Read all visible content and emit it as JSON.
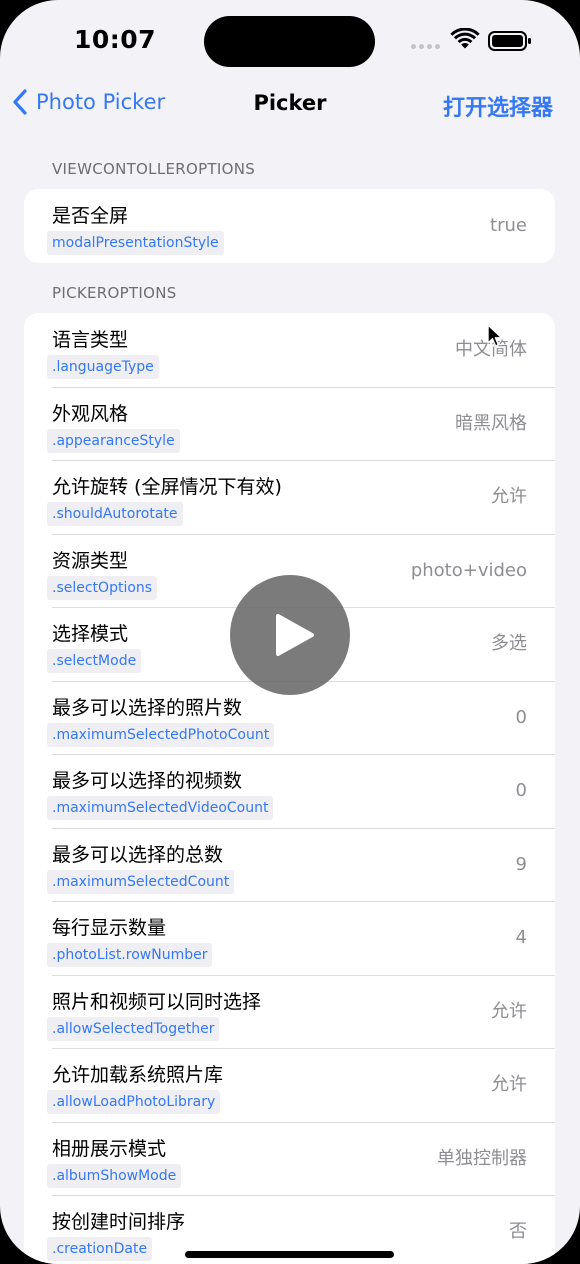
{
  "status_bar": {
    "time": "10:07"
  },
  "nav": {
    "back_label": "Photo Picker",
    "title": "Picker",
    "right_label": "打开选择器"
  },
  "sections": [
    {
      "header": "VIEWCONTOLLEROPTIONS",
      "rows": [
        {
          "title": "是否全屏",
          "tag": "modalPresentationStyle",
          "value": "true"
        }
      ]
    },
    {
      "header": "PICKEROPTIONS",
      "rows": [
        {
          "title": "语言类型",
          "tag": ".languageType",
          "value": "中文简体"
        },
        {
          "title": "外观风格",
          "tag": ".appearanceStyle",
          "value": "暗黑风格"
        },
        {
          "title": "允许旋转 (全屏情况下有效)",
          "tag": ".shouldAutorotate",
          "value": "允许"
        },
        {
          "title": "资源类型",
          "tag": ".selectOptions",
          "value": "photo+video"
        },
        {
          "title": "选择模式",
          "tag": ".selectMode",
          "value": "多选"
        },
        {
          "title": "最多可以选择的照片数",
          "tag": ".maximumSelectedPhotoCount",
          "value": "0"
        },
        {
          "title": "最多可以选择的视频数",
          "tag": ".maximumSelectedVideoCount",
          "value": "0"
        },
        {
          "title": "最多可以选择的总数",
          "tag": ".maximumSelectedCount",
          "value": "9"
        },
        {
          "title": "每行显示数量",
          "tag": ".photoList.rowNumber",
          "value": "4"
        },
        {
          "title": "照片和视频可以同时选择",
          "tag": ".allowSelectedTogether",
          "value": "允许"
        },
        {
          "title": "允许加载系统照片库",
          "tag": ".allowLoadPhotoLibrary",
          "value": "允许"
        },
        {
          "title": "相册展示模式",
          "tag": ".albumShowMode",
          "value": "单独控制器"
        },
        {
          "title": "按创建时间排序",
          "tag": ".creationDate",
          "value": "否"
        }
      ]
    }
  ],
  "icons": {
    "back": "chevron-left-icon",
    "wifi": "wifi-icon",
    "battery": "battery-icon",
    "signal": "cellular-signal-icon",
    "play": "play-icon",
    "cursor": "mouse-cursor-icon"
  },
  "colors": {
    "accent": "#3478f6",
    "background": "#f2f2f7",
    "card": "#ffffff",
    "secondary_text": "#8e8e93"
  }
}
